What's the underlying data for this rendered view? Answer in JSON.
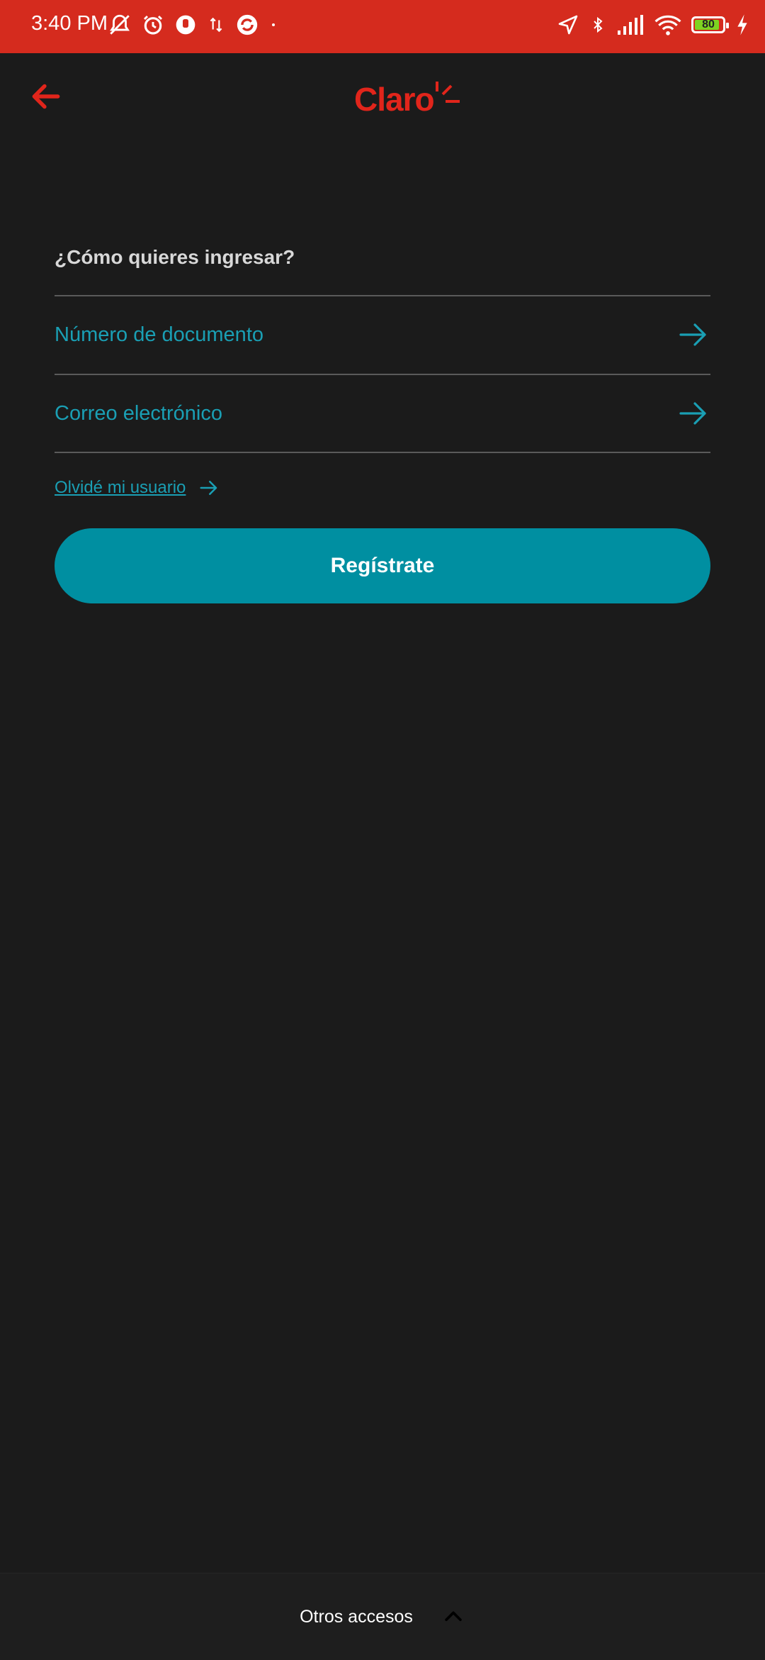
{
  "status_bar": {
    "time": "3:40 PM",
    "battery_level": "80",
    "battery_fraction": 0.8,
    "left_icons": [
      "notifications-off-icon",
      "alarm-icon",
      "app-icon",
      "data-transfer-icon",
      "sync-app-icon",
      "dot-icon"
    ],
    "right_icons": [
      "location-icon",
      "bluetooth-icon",
      "signal-icon",
      "wifi-icon",
      "battery-icon",
      "charging-icon"
    ]
  },
  "header": {
    "logo_text": "Claro",
    "back_icon": "arrow-left-icon"
  },
  "login": {
    "question": "¿Cómo quieres ingresar?",
    "options": [
      {
        "label": "Número de documento",
        "icon": "arrow-right-icon"
      },
      {
        "label": "Correo electrónico",
        "icon": "arrow-right-icon"
      }
    ],
    "forgot_user": "Olvidé mi usuario",
    "register_button": "Regístrate"
  },
  "bottom_bar": {
    "label": "Otros accesos",
    "icon": "chevron-up-icon"
  },
  "colors": {
    "status_bar": "#d52b1e",
    "background": "#1b1b1b",
    "accent": "#008fa1",
    "link": "#1a9fb4",
    "brand_red": "#e1251b"
  }
}
